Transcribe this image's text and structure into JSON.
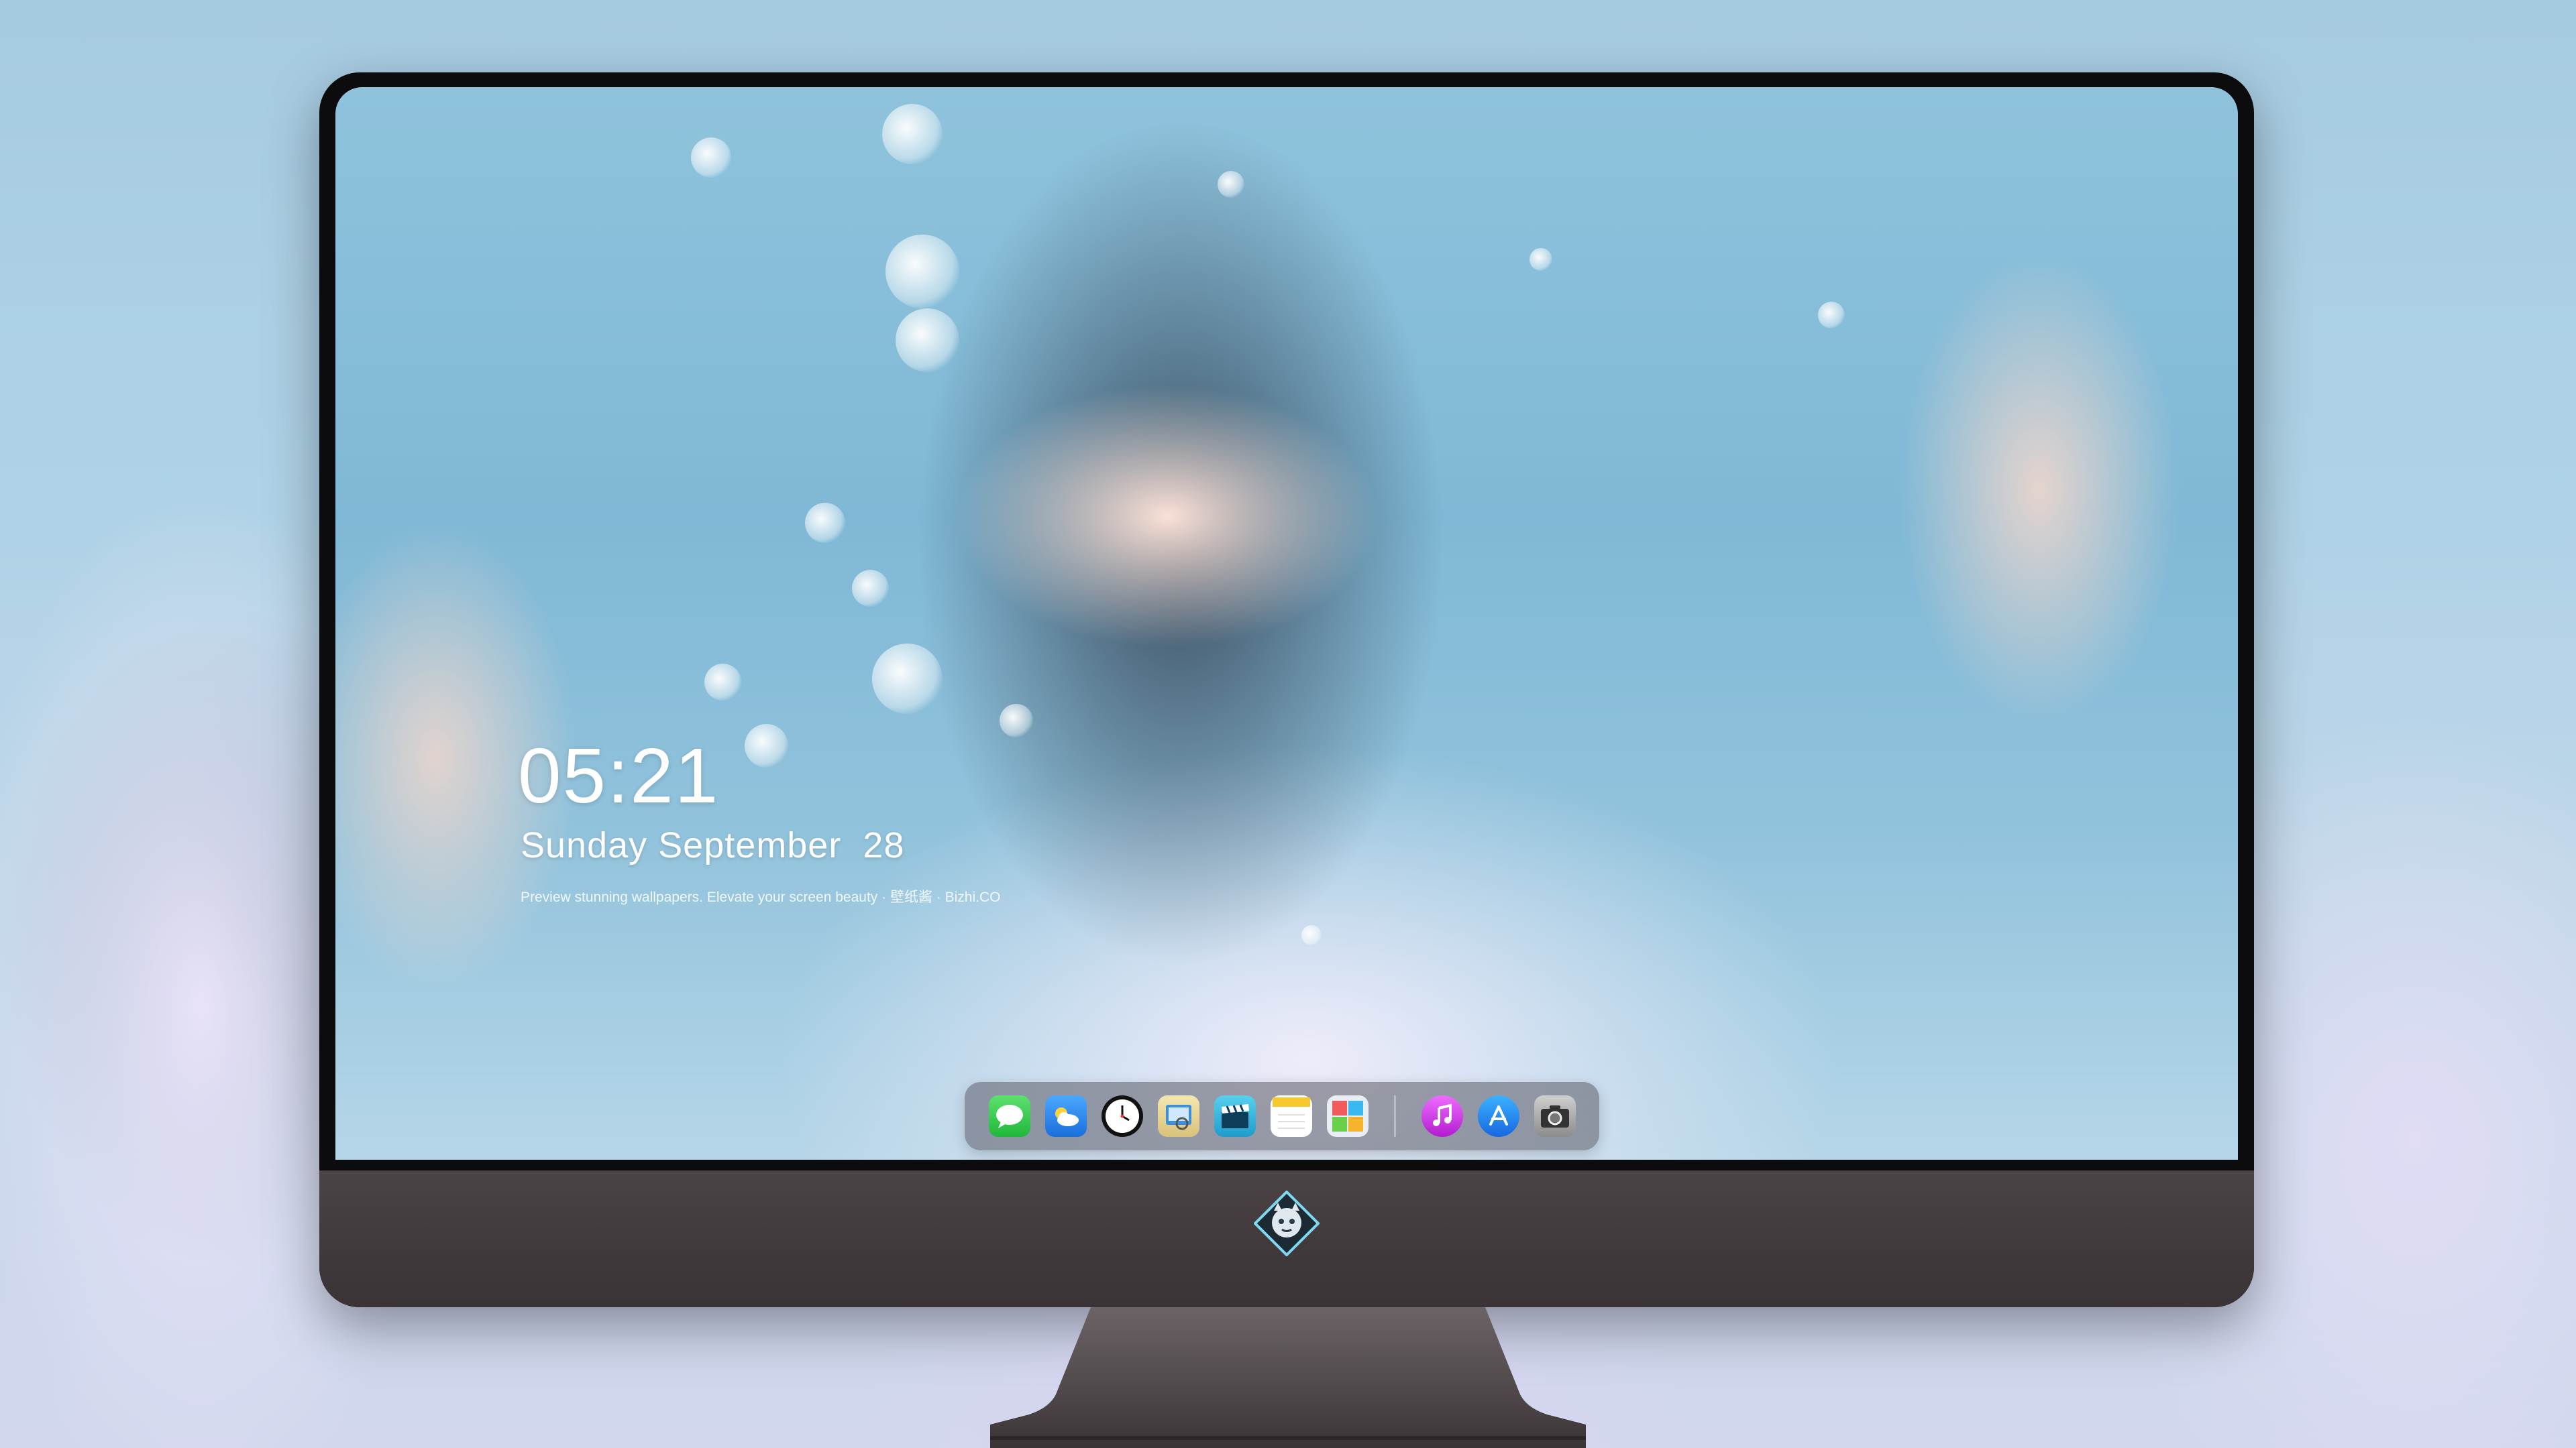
{
  "lockscreen": {
    "time": "05:21",
    "date": "Sunday September  28",
    "tagline": "Preview stunning wallpapers. Elevate your screen beauty · 壁纸酱 · Bizhi.CO"
  },
  "dock": {
    "apps": [
      {
        "name": "Messages",
        "icon": "messages-icon",
        "color": "#2fc84a"
      },
      {
        "name": "Weather",
        "icon": "weather-icon",
        "color": "#2a8ff0"
      },
      {
        "name": "Clock",
        "icon": "clock-icon",
        "color": "#111111"
      },
      {
        "name": "Preview",
        "icon": "preview-icon",
        "color": "#3e8fd8"
      },
      {
        "name": "Final Cut",
        "icon": "clapperboard-icon",
        "color": "#2fb5d8"
      },
      {
        "name": "Notes",
        "icon": "notes-icon",
        "color": "#f7c92c"
      },
      {
        "name": "Photo Booth",
        "icon": "photo-booth-icon",
        "color": "#e8eef4"
      },
      {
        "name": "iTunes",
        "icon": "music-icon",
        "color": "#d42de0"
      },
      {
        "name": "App Store",
        "icon": "app-store-icon",
        "color": "#1f8ef0"
      },
      {
        "name": "Camera",
        "icon": "camera-icon",
        "color": "#555555"
      }
    ]
  },
  "brand": {
    "icon": "monitor-logo-icon"
  },
  "colors": {
    "dock_bg": "#5a5a64",
    "chin": "#443e41",
    "bezel": "#0c0c0e"
  }
}
